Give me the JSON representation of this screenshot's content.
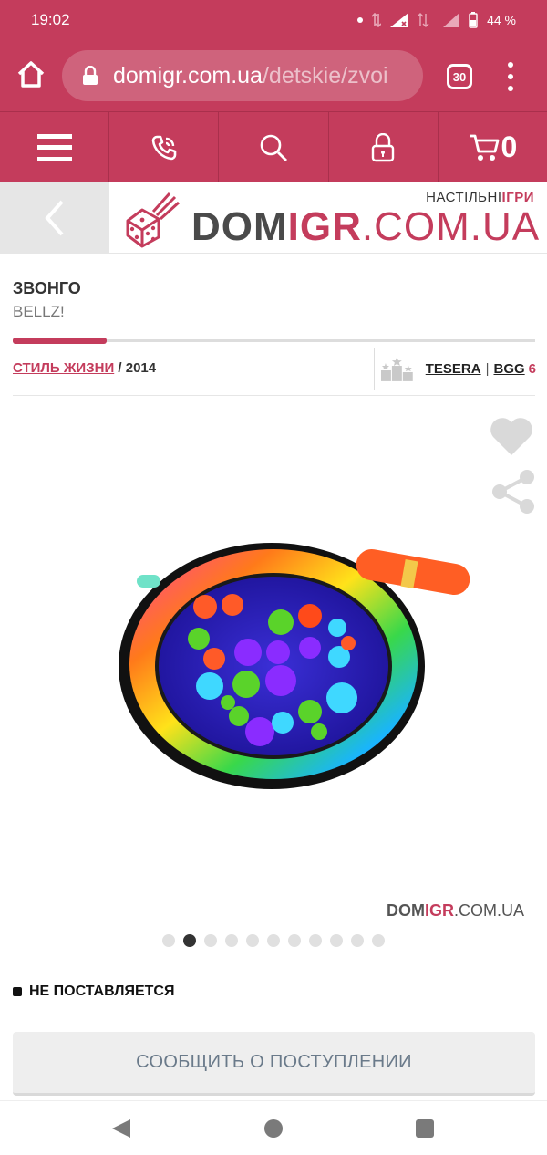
{
  "status_bar": {
    "time": "19:02",
    "battery": "44 %"
  },
  "browser": {
    "url_domain": "domigr.com.ua",
    "url_path": "/detskie/zvoi",
    "tab_count": "30"
  },
  "nav": {
    "cart_count": "0"
  },
  "logo": {
    "tag_prefix": "НАСТІЛЬНІ",
    "tag_accent": "ІГРИ",
    "name_dom": "DOM",
    "name_igr": "IGR",
    "name_rest": ".COM.UA"
  },
  "product": {
    "title": "ЗВОНГО",
    "subtitle": "BELLZ!",
    "publisher": "СТИЛЬ ЖИЗНИ",
    "year": "/ 2014",
    "progress": 0.18
  },
  "ratings": {
    "tesera": "TESERA",
    "separator": "|",
    "bgg": "BGG",
    "bgg_score": "6"
  },
  "watermark": {
    "dom": "DOM",
    "igr": "IGR",
    "rest": ".COM.UA"
  },
  "gallery": {
    "total": 11,
    "active_index": 1
  },
  "availability": {
    "status": "НЕ ПОСТАВЛЯЕТСЯ"
  },
  "actions": {
    "notify_label": "СООБЩИТЬ О ПОСТУПЛЕНИИ"
  },
  "colors": {
    "brand": "#c43c5c"
  }
}
